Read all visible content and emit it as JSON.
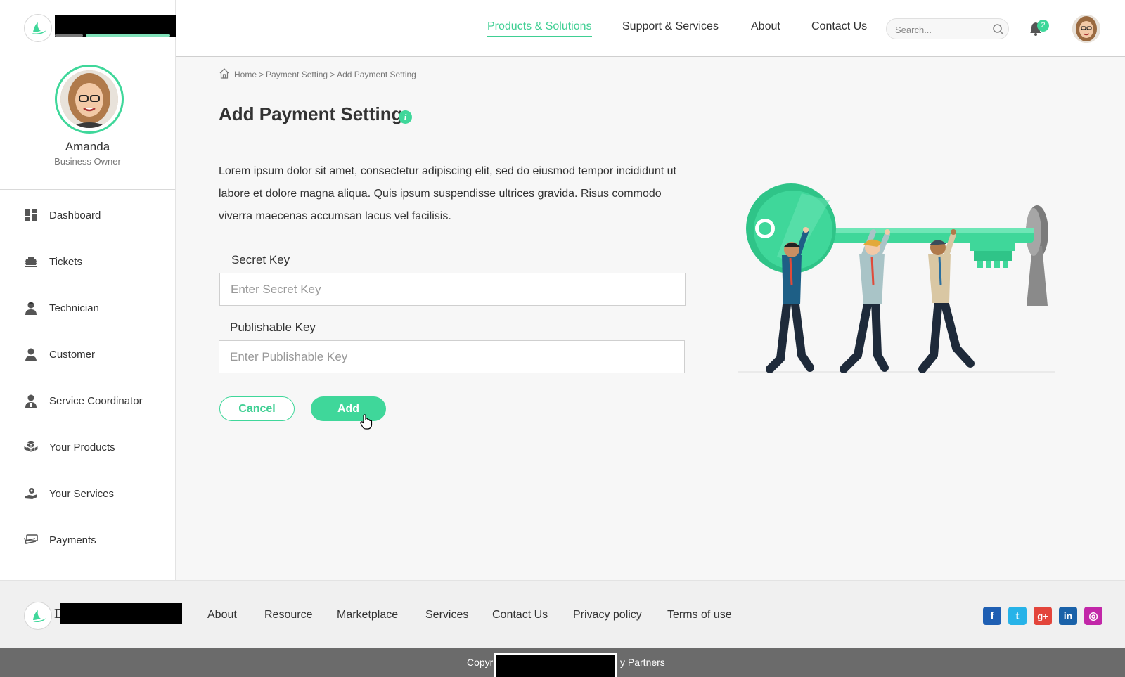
{
  "header": {
    "nav": [
      {
        "label": "Products & Solutions",
        "active": true
      },
      {
        "label": "Support & Services"
      },
      {
        "label": "About"
      },
      {
        "label": "Contact Us"
      }
    ],
    "search_placeholder": "Search...",
    "notification_count": "2"
  },
  "profile": {
    "name": "Amanda",
    "role": "Business Owner"
  },
  "sidebar": {
    "items": [
      {
        "label": "Dashboard",
        "icon": "dashboard-icon"
      },
      {
        "label": "Tickets",
        "icon": "tickets-icon"
      },
      {
        "label": "Technician",
        "icon": "technician-icon"
      },
      {
        "label": "Customer",
        "icon": "customer-icon"
      },
      {
        "label": "Service Coordinator",
        "icon": "service-coordinator-icon"
      },
      {
        "label": "Your Products",
        "icon": "products-icon"
      },
      {
        "label": "Your Services",
        "icon": "services-icon"
      },
      {
        "label": "Payments",
        "icon": "payments-icon"
      }
    ]
  },
  "breadcrumb": {
    "home": "Home",
    "separator": ">",
    "level1": "Payment Setting",
    "current": "Add Payment Setting"
  },
  "page": {
    "title": "Add Payment Setting",
    "description": "Lorem ipsum dolor sit amet, consectetur adipiscing elit, sed do eiusmod tempor incididunt ut labore et dolore magna aliqua. Quis ipsum suspendisse ultrices gravida. Risus commodo viverra maecenas accumsan lacus vel facilisis."
  },
  "form": {
    "secret_key_label": "Secret Key",
    "secret_key_placeholder": "Enter Secret Key",
    "secret_key_value": "",
    "publishable_key_label": "Publishable Key",
    "publishable_key_placeholder": "Enter Publishable Key",
    "publishable_key_value": "",
    "cancel_label": "Cancel",
    "add_label": "Add"
  },
  "footer": {
    "logo_letter": "D",
    "links": [
      "About",
      "Resource",
      "Marketplace",
      "Services",
      "Contact Us",
      "Privacy policy",
      "Terms of use"
    ],
    "social": [
      {
        "name": "facebook-icon",
        "glyph": "f",
        "color": "#1f5fb3"
      },
      {
        "name": "twitter-icon",
        "glyph": "t",
        "color": "#27b3e8"
      },
      {
        "name": "google-plus-icon",
        "glyph": "g+",
        "color": "#e3453b"
      },
      {
        "name": "linkedin-icon",
        "glyph": "in",
        "color": "#1a62a9"
      },
      {
        "name": "instagram-icon",
        "glyph": "◎",
        "color": "#c227a8"
      }
    ],
    "copyright_left": "Copyr",
    "copyright_right": "y Partners"
  },
  "colors": {
    "accent": "#3fd79a",
    "accent_text": "#3fcf93"
  }
}
